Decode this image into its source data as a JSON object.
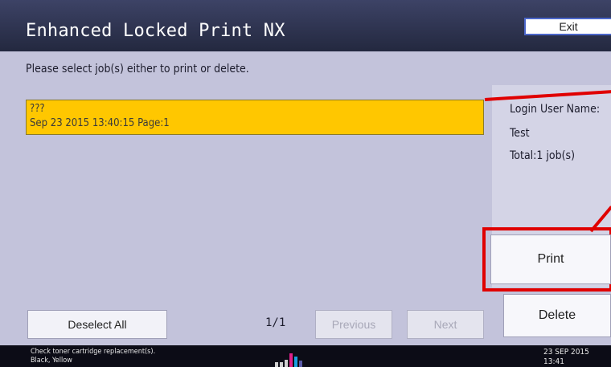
{
  "header": {
    "title": "Enhanced Locked Print NX",
    "exit_label": "Exit"
  },
  "instruction": "Please select job(s) either to print or delete.",
  "jobs": [
    {
      "name": "???",
      "details": "Sep 23 2015 13:40:15  Page:1",
      "selected": true
    }
  ],
  "info": {
    "login_label": "Login User Name:",
    "user_name": "Test",
    "total": "Total:1 job(s)"
  },
  "actions": {
    "print_label": "Print",
    "delete_label": "Delete"
  },
  "pager": {
    "deselect_label": "Deselect All",
    "page_indicator": "1/1",
    "previous_label": "Previous",
    "next_label": "Next"
  },
  "status": {
    "message_line1": "Check toner cartridge replacement(s).",
    "message_line2": "Black, Yellow",
    "toner_icon": "toner-level-icon",
    "date": "23 SEP  2015",
    "time": "13:41"
  },
  "colors": {
    "title_bar": "#2c3150",
    "background": "#c3c3db",
    "selected_row": "#ffc700",
    "highlight": "#e00000"
  }
}
